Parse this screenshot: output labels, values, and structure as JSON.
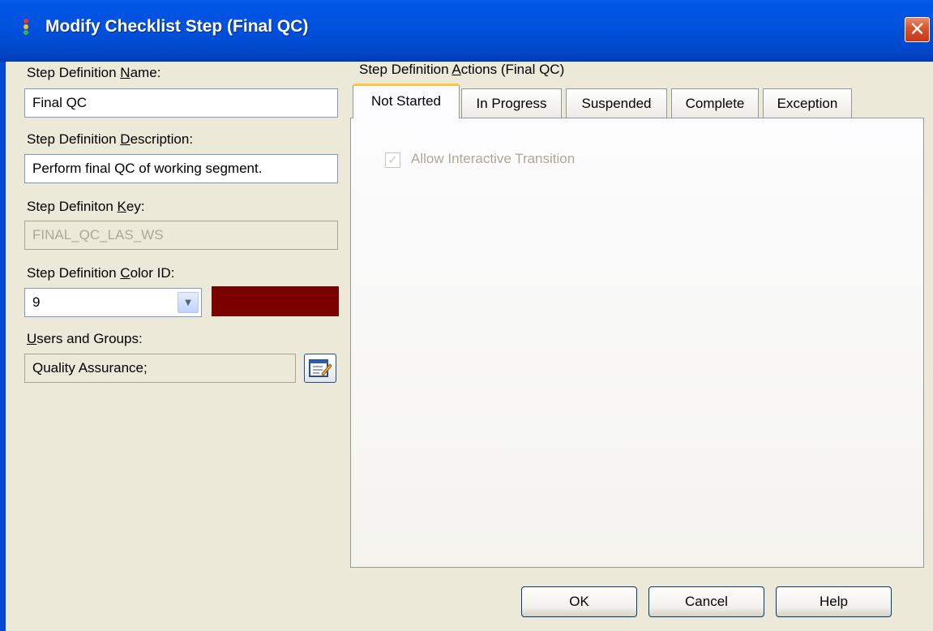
{
  "window": {
    "title": "Modify Checklist Step  (Final QC)",
    "close_glyph": "✕"
  },
  "form": {
    "name_label_pre": "Step Definition ",
    "name_label_key": "N",
    "name_label_post": "ame:",
    "name_value": "Final QC",
    "desc_label_pre": "Step Definition ",
    "desc_label_key": "D",
    "desc_label_post": "escription:",
    "desc_value": "Perform final QC of working segment.",
    "key_label_pre": "Step Definiton ",
    "key_label_key": "K",
    "key_label_post": "ey:",
    "key_value": "FINAL_QC_LAS_WS",
    "color_label_pre": "Step Definition ",
    "color_label_key": "C",
    "color_label_post": "olor ID:",
    "color_value": "9",
    "color_swatch": "#7a0000",
    "users_label_key": "U",
    "users_label_post": "sers and Groups:",
    "users_value": "Quality Assurance;"
  },
  "actions": {
    "label_pre": "Step Definition ",
    "label_key": "A",
    "label_post": "ctions  (Final QC)",
    "tabs": [
      "Not Started",
      "In Progress",
      "Suspended",
      "Complete",
      "Exception"
    ],
    "active_tab": "Not Started",
    "checkbox_label": "Allow Interactive Transition",
    "checkbox_checked": true
  },
  "buttons": {
    "ok": "OK",
    "cancel": "Cancel",
    "help": "Help"
  },
  "colors": {
    "title_bar": "#0054e3",
    "dialog_bg": "#ece9d8",
    "tab_accent": "#ffc73c"
  }
}
